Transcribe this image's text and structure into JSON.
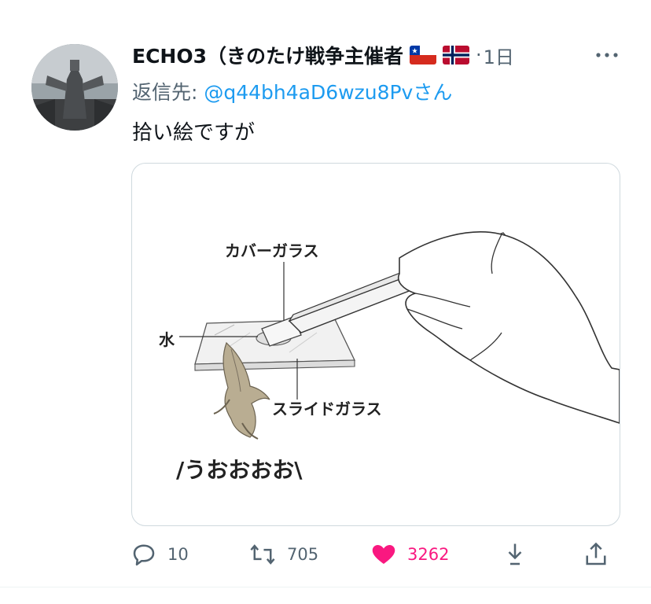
{
  "tweet": {
    "display_name": "ECHO3（きのたけ戦争主催者",
    "flags": [
      "chile-flag",
      "norway-flag"
    ],
    "separator": "·",
    "timestamp": "1日",
    "reply_prefix": "返信先: ",
    "reply_handle": "@q44bh4aD6wzu8Pv",
    "reply_suffix": "さん",
    "text": "拾い絵ですが"
  },
  "media": {
    "label_cover_glass": "カバーガラス",
    "label_water": "水",
    "label_slide_glass": "スライドガラス",
    "caption": "/うおおおお\\"
  },
  "actions": {
    "reply_count": "10",
    "retweet_count": "705",
    "like_count": "3262"
  },
  "colors": {
    "accent": "#1d9bf0",
    "like": "#f91880",
    "muted": "#536471"
  }
}
